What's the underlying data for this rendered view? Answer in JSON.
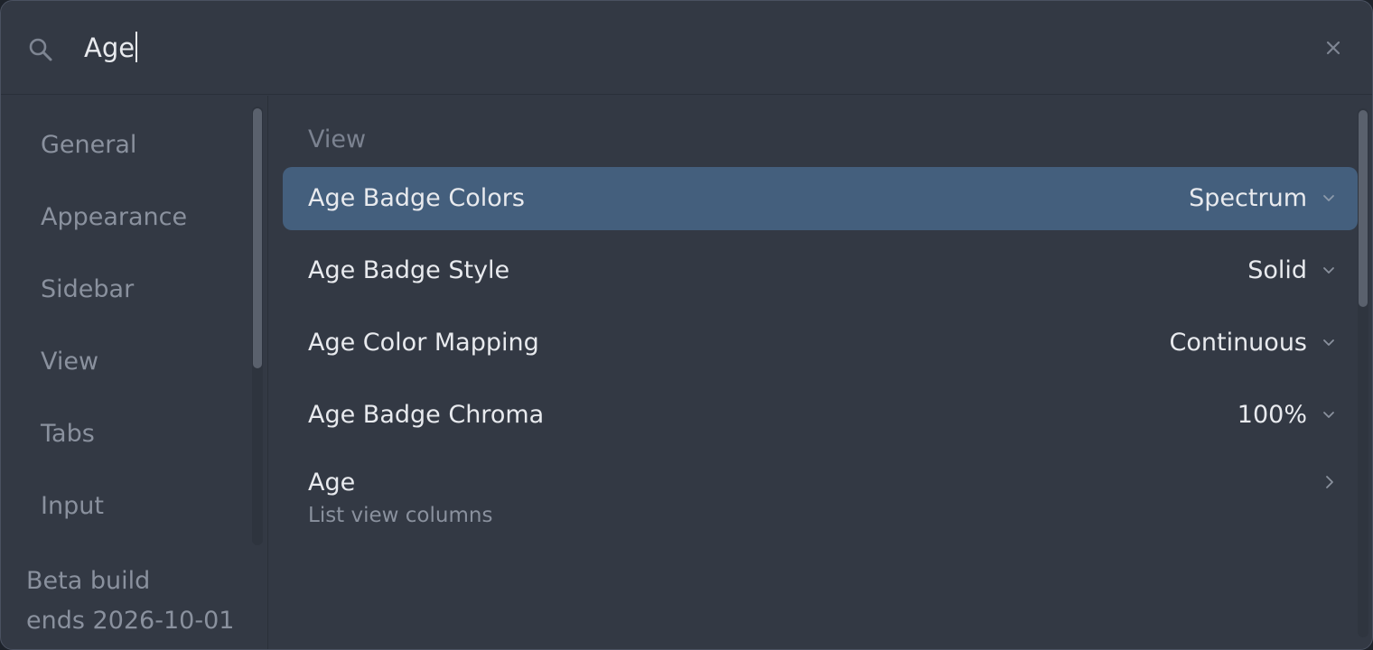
{
  "search": {
    "value": "Age",
    "placeholder": ""
  },
  "sidebar": {
    "items": [
      {
        "label": "General"
      },
      {
        "label": "Appearance"
      },
      {
        "label": "Sidebar"
      },
      {
        "label": "View"
      },
      {
        "label": "Tabs"
      },
      {
        "label": "Input"
      }
    ],
    "footer_line1": "Beta build",
    "footer_line2": "ends 2026-10-01"
  },
  "main": {
    "section_heading": "View",
    "settings": [
      {
        "label": "Age Badge Colors",
        "value": "Spectrum",
        "selected": true
      },
      {
        "label": "Age Badge Style",
        "value": "Solid",
        "selected": false
      },
      {
        "label": "Age Color Mapping",
        "value": "Continuous",
        "selected": false
      },
      {
        "label": "Age Badge Chroma",
        "value": "100%",
        "selected": false
      }
    ],
    "link_row": {
      "label": "Age",
      "sublabel": "List view columns"
    }
  },
  "colors": {
    "background": "#333944",
    "selected_row": "#445f7d",
    "text_primary": "#e8eaee",
    "text_muted": "#8a919e"
  },
  "icons": {
    "search": "search-icon",
    "close": "close-icon",
    "dropdown": "chevron-down-icon",
    "link": "chevron-right-icon"
  }
}
